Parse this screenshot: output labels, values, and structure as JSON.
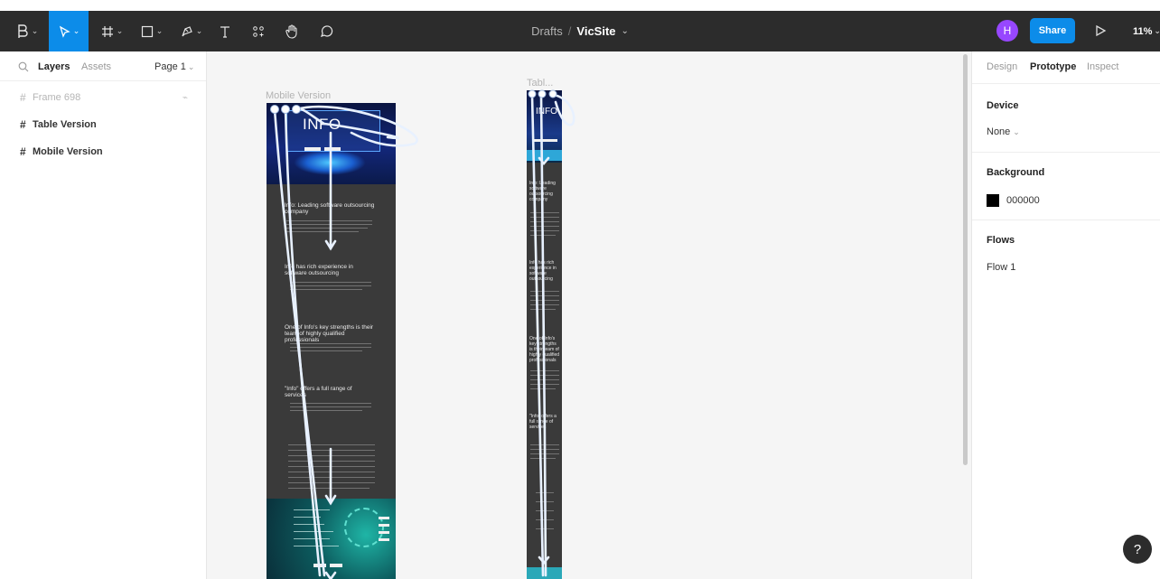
{
  "toolbar": {
    "tools": [
      {
        "name": "main-menu-icon",
        "active": false
      },
      {
        "name": "move-tool-icon",
        "active": true
      },
      {
        "name": "frame-tool-icon",
        "active": false
      },
      {
        "name": "shape-tool-icon",
        "active": false
      },
      {
        "name": "pen-tool-icon",
        "active": false
      },
      {
        "name": "text-tool-icon",
        "active": false
      },
      {
        "name": "resources-icon",
        "active": false
      },
      {
        "name": "hand-tool-icon",
        "active": false
      },
      {
        "name": "comment-tool-icon",
        "active": false
      }
    ],
    "breadcrumb_parent": "Drafts",
    "breadcrumb_sep": "/",
    "file_name": "VicSite",
    "avatar_initial": "H",
    "share_label": "Share",
    "zoom": "11%",
    "colors": {
      "bar": "#2c2c2c",
      "accent": "#0c8ce9",
      "avatar": "#9747ff"
    }
  },
  "left_panel": {
    "tabs": {
      "layers": "Layers",
      "assets": "Assets"
    },
    "page_selector": "Page 1",
    "layers": [
      {
        "label": "Frame 698",
        "dim": true
      },
      {
        "label": "Table Version",
        "dim": false
      },
      {
        "label": "Mobile Version",
        "dim": false
      }
    ],
    "frame_698_extra": "⌁"
  },
  "canvas": {
    "frames": [
      {
        "label": "Mobile Version"
      },
      {
        "label": "Tabl..."
      }
    ],
    "mobile": {
      "hero_title": "INFO",
      "sections": [
        "Info: Leading software outsourcing company",
        "Info has rich experience in software outsourcing",
        "One of Info's key strengths is their team of highly qualified professionals",
        "\"Info\" offers a full range of services"
      ]
    },
    "tablet": {
      "hero_title": "INFO",
      "sections": [
        "Info: Leading software outsourcing company",
        "Info has rich experience in software outsourcing",
        "One of Info's key strengths is their team of highly qualified professionals",
        "\"Info\" offers a full range of services"
      ]
    }
  },
  "right_panel": {
    "tabs": {
      "design": "Design",
      "prototype": "Prototype",
      "inspect": "Inspect"
    },
    "device_heading": "Device",
    "device_value": "None",
    "background_heading": "Background",
    "background_color": "000000",
    "background_swatch": "#000000",
    "flows_heading": "Flows",
    "flow_item": "Flow 1"
  },
  "help_label": "?"
}
